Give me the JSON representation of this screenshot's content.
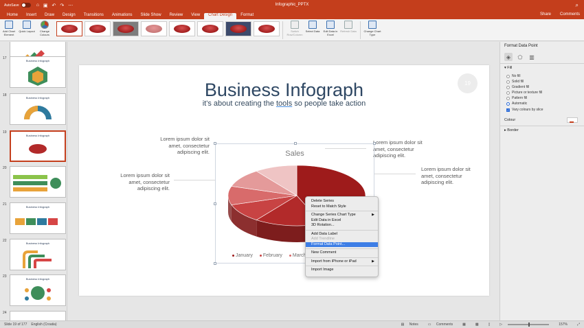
{
  "titlebar": {
    "autosave": "AutoSave",
    "autosave_state": "OFF",
    "document_title": "Infographic_PPTX",
    "search_icon": "search-icon"
  },
  "tabs": [
    "Home",
    "Insert",
    "Draw",
    "Design",
    "Transitions",
    "Animations",
    "Slide Show",
    "Review",
    "View",
    "Chart Design",
    "Format"
  ],
  "active_tab": "Chart Design",
  "share": "Share",
  "comments": "Comments",
  "ribbon": {
    "add_chart_element": "Add Chart Element",
    "quick_layout": "Quick Layout",
    "change_colours": "Change Colours",
    "switch_row_column": "Switch Row/Column",
    "select_data": "Select Data",
    "edit_data_in_excel": "Edit Data in Excel",
    "refresh_data": "Refresh Data",
    "change_chart_type": "Change Chart Type"
  },
  "slides": [
    {
      "num": "17",
      "title": "Business Infograph"
    },
    {
      "num": "18",
      "title": "Business Infograph"
    },
    {
      "num": "19",
      "title": "Business Infograph"
    },
    {
      "num": "20",
      "title": "Business Infograph"
    },
    {
      "num": "21",
      "title": "Business Infograph"
    },
    {
      "num": "22",
      "title": "Business Infograph"
    },
    {
      "num": "23",
      "title": "Business Infograph"
    },
    {
      "num": "24",
      "title": ""
    }
  ],
  "slide": {
    "title": "Business Infograph",
    "subtitle_pre": "it's about creating the ",
    "subtitle_underlined": "tools",
    "subtitle_post": " so people take action",
    "number": "19",
    "lorem_top_left": "Lorem ipsum dolor sit amet, consectetur adipiscing elit.",
    "lorem_mid_left": "Lorem ipsum dolor sit amet, consectetur adipiscing elit.",
    "lorem_top_right": "Lorem ipsum dolor sit amet, consectetur adipiscing elit.",
    "lorem_mid_right": "Lorem ipsum dolor sit amet, consectetur adipiscing elit."
  },
  "chart_data": {
    "type": "pie",
    "title": "Sales",
    "legend_position": "bottom",
    "legend": [
      "January",
      "February",
      "March"
    ],
    "colors": [
      "#9e1b1b",
      "#b22a2a",
      "#c84343",
      "#d86b6b",
      "#e49a9a",
      "#efc4c4"
    ],
    "slices": [
      {
        "name": "January",
        "value": 44
      },
      {
        "name": "February",
        "value": 16
      },
      {
        "name": "March",
        "value": 10
      },
      {
        "name": "",
        "value": 10
      },
      {
        "name": "",
        "value": 10
      },
      {
        "name": "",
        "value": 10
      }
    ]
  },
  "context_menu": {
    "items": [
      {
        "label": "Delete Series",
        "disabled": false,
        "submenu": false,
        "highlight": false
      },
      {
        "label": "Reset to Match Style",
        "disabled": false,
        "submenu": false,
        "highlight": false
      },
      {
        "sep": true
      },
      {
        "label": "Change Series Chart Type",
        "disabled": false,
        "submenu": true,
        "highlight": false
      },
      {
        "label": "Edit Data in Excel",
        "disabled": false,
        "submenu": false,
        "highlight": false
      },
      {
        "label": "3D Rotation...",
        "disabled": false,
        "submenu": false,
        "highlight": false
      },
      {
        "sep": true
      },
      {
        "label": "Add Data Label",
        "disabled": false,
        "submenu": false,
        "highlight": false
      },
      {
        "label": "Add Trendline",
        "disabled": true,
        "submenu": false,
        "highlight": false
      },
      {
        "label": "Format Data Point...",
        "disabled": false,
        "submenu": false,
        "highlight": true
      },
      {
        "sep": true
      },
      {
        "label": "New Comment",
        "disabled": false,
        "submenu": false,
        "highlight": false
      },
      {
        "sep": true
      },
      {
        "label": "Import from iPhone or iPad",
        "disabled": false,
        "submenu": true,
        "highlight": false
      },
      {
        "sep": true
      },
      {
        "label": "Import Image",
        "disabled": false,
        "submenu": false,
        "highlight": false
      }
    ]
  },
  "format_pane": {
    "title": "Format Data Point",
    "fill_section": "Fill",
    "options": [
      "No fill",
      "Solid fill",
      "Gradient fill",
      "Picture or texture fill",
      "Pattern fill",
      "Automatic"
    ],
    "selected_option": "Automatic",
    "vary_colours": "Vary colours by slice",
    "colour_label": "Colour",
    "border_section": "Border"
  },
  "statusbar": {
    "slide_info": "Slide 19 of 177",
    "language": "English (Croatia)",
    "notes": "Notes",
    "comments": "Comments",
    "zoom": "157%"
  }
}
